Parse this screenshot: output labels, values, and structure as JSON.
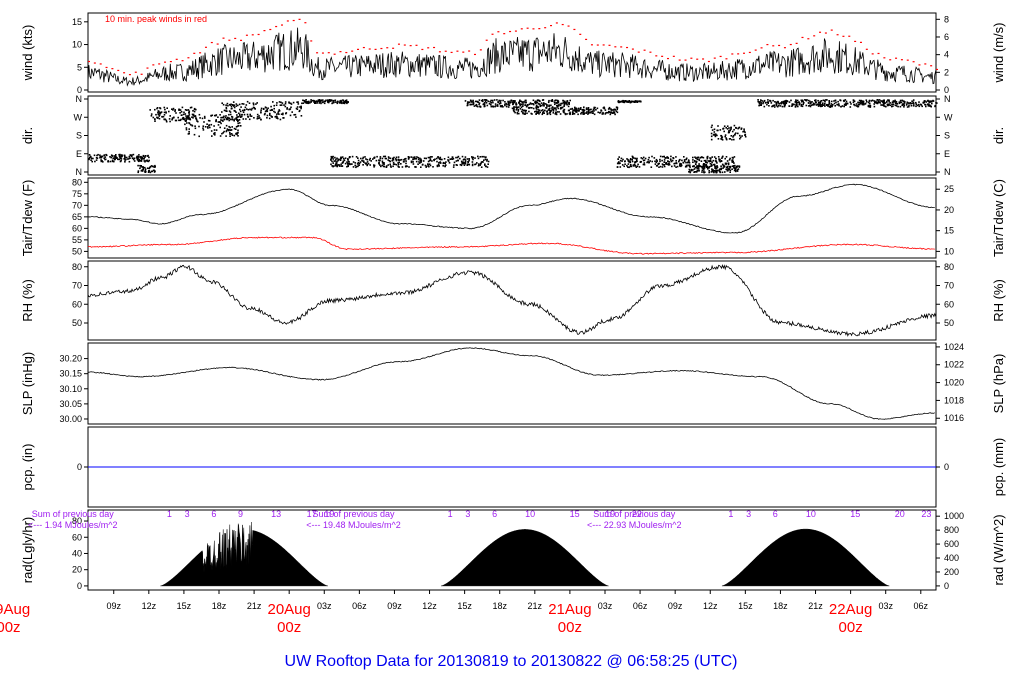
{
  "title": "UW Rooftop Data for 20130819  to  20130822 @ 06:58:25  (UTC)",
  "colors": {
    "title": "#0000ee",
    "date": "#ff0000",
    "peak": "#ff0000",
    "dew": "#ff0000",
    "pcp": "#0000ff",
    "annot": "#a020f0"
  },
  "chart_data": [
    {
      "type": "line",
      "title": "wind",
      "ylabel": "wind (kts)",
      "ylabel_right": "wind (m/s)",
      "annotation": "10 min. peak winds in red",
      "ylim": [
        0,
        16.5
      ],
      "yticks": [
        0,
        5,
        10,
        15
      ],
      "yticks_right": [
        0,
        2,
        4,
        6,
        8
      ],
      "x_hours_from_20Aug00z": [
        -17.2,
        -13.6,
        -10,
        -5,
        1,
        2.5,
        9.5,
        15.5,
        18,
        23,
        26.5,
        35,
        41.8,
        46,
        52,
        55.3
      ],
      "mean_kts": [
        4,
        2,
        4,
        7,
        9.5,
        5,
        6,
        5,
        8,
        9,
        6,
        4,
        6,
        8,
        4,
        3
      ]
    },
    {
      "type": "scatter",
      "title": "dir.",
      "ylabel": "dir.",
      "ylabel_right": "dir.",
      "yticks": [
        "N",
        "E",
        "S",
        "W",
        "N"
      ],
      "segments": [
        [
          -17.2,
          -12,
          0.8,
          0.2
        ],
        [
          -13,
          -11.5,
          0.2,
          0.2
        ],
        [
          -12,
          -8,
          3.2,
          0.4
        ],
        [
          -9,
          -4,
          2.6,
          0.6
        ],
        [
          -6,
          1,
          3.4,
          0.5
        ],
        [
          1,
          5,
          3.9,
          0.1
        ],
        [
          3.5,
          17,
          0.6,
          0.3
        ],
        [
          15,
          24,
          3.8,
          0.2
        ],
        [
          19,
          28,
          3.4,
          0.2
        ],
        [
          28,
          30,
          3.9,
          0.05
        ],
        [
          28,
          38,
          0.6,
          0.3
        ],
        [
          34,
          38.5,
          0.2,
          0.2
        ],
        [
          40,
          55.3,
          3.8,
          0.2
        ],
        [
          36,
          39,
          2.2,
          0.4
        ]
      ]
    },
    {
      "type": "line",
      "title": "Tair/Tdew",
      "ylabel": "Tair/Tdew (F)",
      "ylabel_right": "Tair/Tdew (C)",
      "ylim": [
        48,
        81
      ],
      "yticks": [
        50,
        55,
        60,
        65,
        70,
        75,
        80
      ],
      "yticks_right": [
        10,
        15,
        20,
        25
      ],
      "tair_x": [
        -17.2,
        -13.6,
        -11,
        -7.6,
        0,
        3.5,
        9.5,
        15.5,
        20.6,
        24,
        30.8,
        38.1,
        43.6,
        48.3,
        55.3
      ],
      "tair": [
        65,
        64,
        62,
        66,
        77,
        70,
        62,
        60,
        70,
        73,
        65,
        58,
        74,
        79,
        69
      ],
      "tdew_x": [
        -17.2,
        -10,
        -3,
        2,
        5,
        15,
        22,
        30,
        38,
        48,
        55.3
      ],
      "tdew": [
        52,
        53,
        56,
        56,
        51,
        52,
        53.5,
        49,
        49.5,
        53,
        51
      ]
    },
    {
      "type": "line",
      "title": "RH",
      "ylabel": "RH (%)",
      "ylabel_right": "RH (%)",
      "ylim": [
        42,
        82
      ],
      "yticks": [
        50,
        60,
        70,
        80
      ],
      "yticks_right": [
        50,
        60,
        70,
        80
      ],
      "x": [
        -17.2,
        -13.6,
        -11,
        -8.9,
        -6.7,
        -3.3,
        -0.3,
        3.5,
        9.5,
        15.5,
        20.6,
        24.9,
        27.5,
        31.9,
        37,
        42.1,
        48.1,
        55.3
      ],
      "values": [
        65,
        67,
        74,
        80,
        72,
        58,
        50,
        62,
        66,
        77,
        60,
        45,
        52,
        70,
        80,
        50,
        44,
        54
      ]
    },
    {
      "type": "line",
      "title": "SLP",
      "ylabel": "SLP (inHg)",
      "ylabel_right": "SLP (hPa)",
      "ylim": [
        29.99,
        30.245
      ],
      "yticks": [
        30.0,
        30.05,
        30.1,
        30.15,
        30.2
      ],
      "yticks_right": [
        1016,
        1018,
        1020,
        1022,
        1024
      ],
      "x": [
        -17.2,
        -12.7,
        -5,
        2.7,
        9.5,
        15.5,
        20.6,
        26.6,
        33.4,
        40.3,
        46.3,
        50.5,
        55.3
      ],
      "values": [
        30.155,
        30.14,
        30.17,
        30.13,
        30.19,
        30.235,
        30.21,
        30.145,
        30.16,
        30.14,
        30.05,
        30.0,
        30.02
      ]
    },
    {
      "type": "line",
      "title": "pcp",
      "ylabel": "pcp. (in)",
      "ylabel_right": "pcp. (mm)",
      "ylim": [
        -1,
        1
      ],
      "yticks": [
        0
      ],
      "yticks_right": [
        0
      ],
      "values_constant": 0
    },
    {
      "type": "area",
      "title": "rad",
      "ylabel": "rad(Lgly/hr)",
      "ylabel_right": "rad (W/m^2)",
      "ylim_wm2": [
        -30,
        1060
      ],
      "yticks": [
        0,
        20,
        40,
        60,
        80
      ],
      "yticks_right": [
        0,
        200,
        400,
        600,
        800,
        1000
      ],
      "days": [
        {
          "sunrise": -11,
          "sunset": 3.3,
          "peak": 810,
          "cloudy": true,
          "sum": "Sum of previous day",
          "sum_value": "<--- 1.94 MJoules/m^2",
          "hours": [
            "1",
            "3",
            "6",
            "9",
            "13",
            "17",
            "19"
          ]
        },
        {
          "sunrise": 13,
          "sunset": 27.3,
          "peak": 810,
          "cloudy": false,
          "sum": "Sum of previous day",
          "sum_value": "<--- 19.48 MJoules/m^2",
          "hours": [
            "1",
            "3",
            "6",
            "10",
            "15",
            "19",
            "22"
          ]
        },
        {
          "sunrise": 37,
          "sunset": 51.3,
          "peak": 815,
          "cloudy": false,
          "sum": "Sum of previous day",
          "sum_value": "<--- 22.93 MJoules/m^2",
          "hours": [
            "1",
            "3",
            "6",
            "10",
            "15",
            "20",
            "23"
          ]
        }
      ]
    },
    {
      "type": "axis",
      "title": "time",
      "xlim_hours": [
        -17.2,
        55.3
      ],
      "tick_labels": [
        "09z",
        "12z",
        "15z",
        "18z",
        "21z",
        "03z",
        "06z",
        "09z",
        "12z",
        "15z",
        "18z",
        "21z",
        "03z",
        "06z",
        "09z",
        "12z",
        "15z",
        "18z",
        "21z",
        "03z",
        "06z"
      ],
      "tick_hours": [
        -15,
        -12,
        -9,
        -6,
        -3,
        3,
        6,
        9,
        12,
        15,
        18,
        21,
        27,
        30,
        33,
        36,
        39,
        42,
        45,
        51,
        54
      ],
      "dates": [
        {
          "label": "19Aug",
          "sub": "00z",
          "hour": -24
        },
        {
          "label": "20Aug",
          "sub": "00z",
          "hour": 0
        },
        {
          "label": "21Aug",
          "sub": "00z",
          "hour": 24
        },
        {
          "label": "22Aug",
          "sub": "00z",
          "hour": 48
        }
      ]
    }
  ]
}
